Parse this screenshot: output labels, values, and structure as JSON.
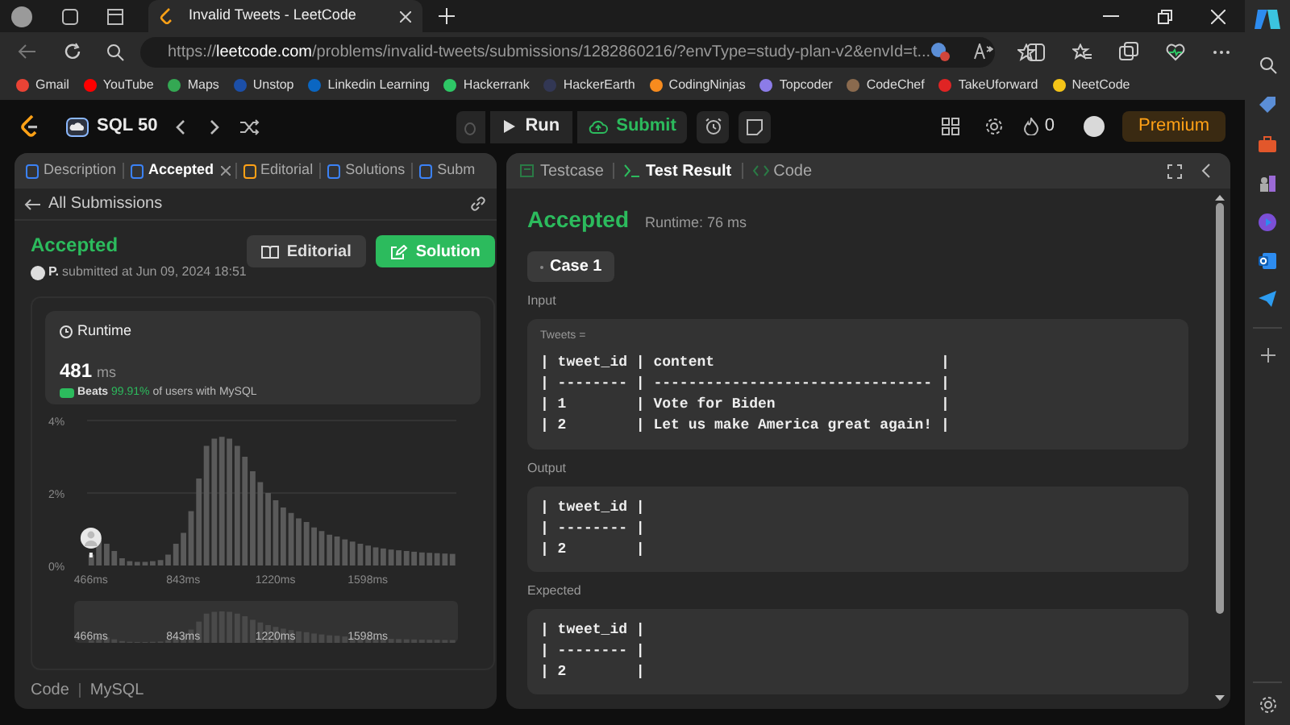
{
  "browser": {
    "tabs": [
      {
        "title": "Invalid Tweets - LeetCode",
        "selected": true
      }
    ],
    "url": {
      "scheme": "https://",
      "domain": "leetcode.com",
      "path": "/problems/invalid-tweets/submissions/1282860216/?envType=study-plan-v2&envId=t..."
    },
    "bookmarks": [
      {
        "label": "Gmail",
        "color": "#ea4335"
      },
      {
        "label": "YouTube",
        "color": "#ff0000"
      },
      {
        "label": "Maps",
        "color": "#34a853"
      },
      {
        "label": "Unstop",
        "color": "#1c4fa8"
      },
      {
        "label": "Linkedin Learning",
        "color": "#0a66c2"
      },
      {
        "label": "Hackerrank",
        "color": "#2ec866"
      },
      {
        "label": "HackerEarth",
        "color": "#323754"
      },
      {
        "label": "CodingNinjas",
        "color": "#f78b1e"
      },
      {
        "label": "Topcoder",
        "color": "#8c7ce8"
      },
      {
        "label": "CodeChef",
        "color": "#8a6a4e"
      },
      {
        "label": "TakeUforward",
        "color": "#e02424"
      },
      {
        "label": "NeetCode",
        "color": "#f5c518"
      }
    ]
  },
  "nav": {
    "title": "SQL 50",
    "run": "Run",
    "submit": "Submit",
    "streak": "0",
    "premium": "Premium"
  },
  "left_panel": {
    "tabs": [
      {
        "label": "Description",
        "selected": false,
        "closable": false
      },
      {
        "label": "Accepted",
        "selected": true,
        "closable": true
      },
      {
        "label": "Editorial",
        "selected": false,
        "closable": false
      },
      {
        "label": "Solutions",
        "selected": false,
        "closable": false
      },
      {
        "label": "Subm",
        "selected": false,
        "closable": false
      }
    ],
    "back_link": "All Submissions",
    "status": "Accepted",
    "author": "P.",
    "submitted": "submitted at Jun 09, 2024 18:51",
    "buttons": [
      "Editorial",
      "Solution"
    ],
    "runtime": {
      "title": "Runtime",
      "value": "481",
      "unit": "ms",
      "beats_label": "Beats",
      "beats_percent": "99.91%",
      "beats_rest": "of users with MySQL"
    },
    "chart_data": {
      "type": "bar",
      "x": [
        466,
        497,
        529,
        560,
        592,
        623,
        654,
        686,
        717,
        749,
        780,
        812,
        843,
        874,
        906,
        937,
        969,
        1000,
        1031,
        1063,
        1094,
        1126,
        1157,
        1189,
        1220,
        1251,
        1283,
        1314,
        1346,
        1377,
        1408,
        1440,
        1471,
        1503,
        1534,
        1566,
        1598,
        1629,
        1660,
        1692,
        1723,
        1755,
        1786,
        1818,
        1849,
        1880,
        1912,
        1943
      ],
      "series": [
        {
          "color": "#5a5a5a",
          "values": [
            0.3,
            0.7,
            0.6,
            0.4,
            0.2,
            0.12,
            0.1,
            0.1,
            0.12,
            0.15,
            0.3,
            0.6,
            0.9,
            1.5,
            2.4,
            3.3,
            3.5,
            3.55,
            3.5,
            3.3,
            3.0,
            2.6,
            2.3,
            2.0,
            1.8,
            1.6,
            1.45,
            1.3,
            1.2,
            1.05,
            0.95,
            0.85,
            0.8,
            0.72,
            0.66,
            0.6,
            0.55,
            0.5,
            0.47,
            0.44,
            0.42,
            0.4,
            0.38,
            0.36,
            0.35,
            0.34,
            0.33,
            0.32
          ]
        }
      ],
      "xticks": [
        {
          "value": 466,
          "label": "466ms"
        },
        {
          "value": 843,
          "label": "843ms"
        },
        {
          "value": 1220,
          "label": "1220ms"
        },
        {
          "value": 1598,
          "label": "1598ms"
        }
      ],
      "yticks": [
        {
          "value": 0,
          "label": "0%"
        },
        {
          "value": 2,
          "label": "2%"
        },
        {
          "value": 4,
          "label": "4%"
        }
      ],
      "xlim": [
        450,
        1960
      ],
      "ylim": [
        0,
        4
      ]
    },
    "navigator_labels": [
      "466ms",
      "843ms",
      "1220ms",
      "1598ms"
    ],
    "footer": [
      "Code",
      "MySQL"
    ]
  },
  "right_panel": {
    "tabs": [
      {
        "label": "Testcase",
        "selected": false
      },
      {
        "label": "Test Result",
        "selected": true
      },
      {
        "label": "Code",
        "selected": false
      }
    ],
    "status": "Accepted",
    "runtime": "Runtime: 76 ms",
    "cases": [
      {
        "label": "Case 1",
        "selected": true
      }
    ],
    "sections": [
      {
        "label": "Input",
        "name": "Tweets =",
        "lines": [
          "| tweet_id | content                          |",
          "| -------- | -------------------------------- |",
          "| 1        | Vote for Biden                   |",
          "| 2        | Let us make America great again! |"
        ]
      },
      {
        "label": "Output",
        "lines": [
          "| tweet_id |",
          "| -------- |",
          "| 2        |"
        ]
      },
      {
        "label": "Expected",
        "lines": [
          "| tweet_id |",
          "| -------- |",
          "| 2        |"
        ]
      }
    ]
  }
}
